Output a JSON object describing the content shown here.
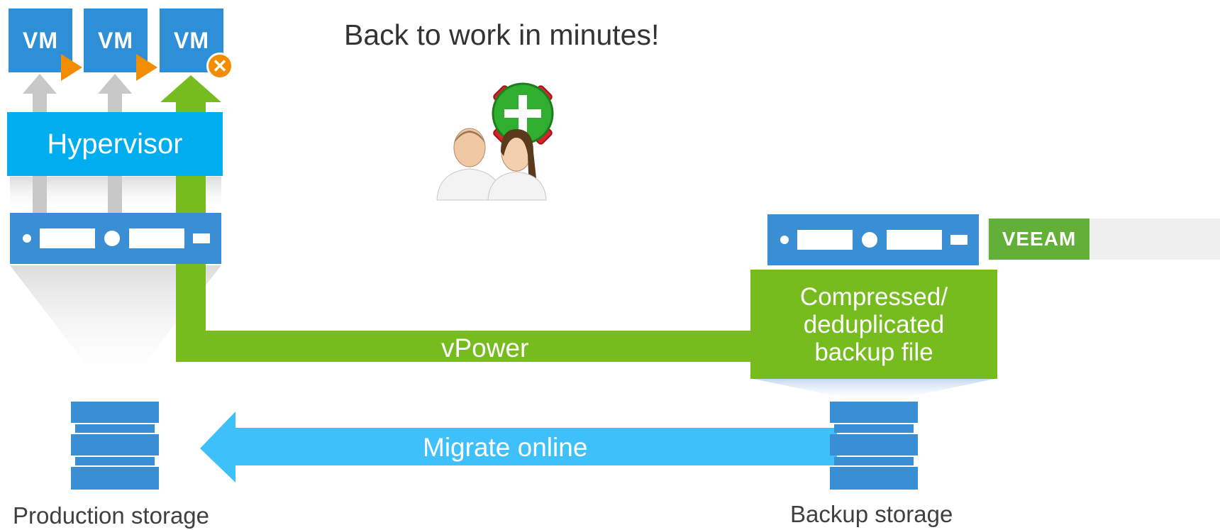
{
  "title": "Back to work in minutes!",
  "vms": [
    {
      "label": "VM",
      "status": "running"
    },
    {
      "label": "VM",
      "status": "running"
    },
    {
      "label": "VM",
      "status": "failed"
    }
  ],
  "failed_symbol": "✕",
  "hypervisor_label": "Hypervisor",
  "vpower_label": "vPower",
  "migrate_label": "Migrate online",
  "backup_file_lines": [
    "Compressed/",
    "deduplicated",
    "backup file"
  ],
  "logo_text": "VEEAM",
  "production_storage_label": "Production storage",
  "backup_storage_label": "Backup storage",
  "icons": {
    "users": "users-add-icon",
    "vm_running": "play-icon",
    "vm_failed": "close-circle-icon",
    "storage": "storage-stack-icon",
    "server": "server-rack-icon"
  },
  "colors": {
    "vm_blue": "#2e8fd6",
    "hypervisor_blue": "#00aeef",
    "green": "#77bc1f",
    "migrate_blue": "#3ec1fb",
    "orange": "#f28c00",
    "gray_arrow": "#c8c8c8"
  }
}
